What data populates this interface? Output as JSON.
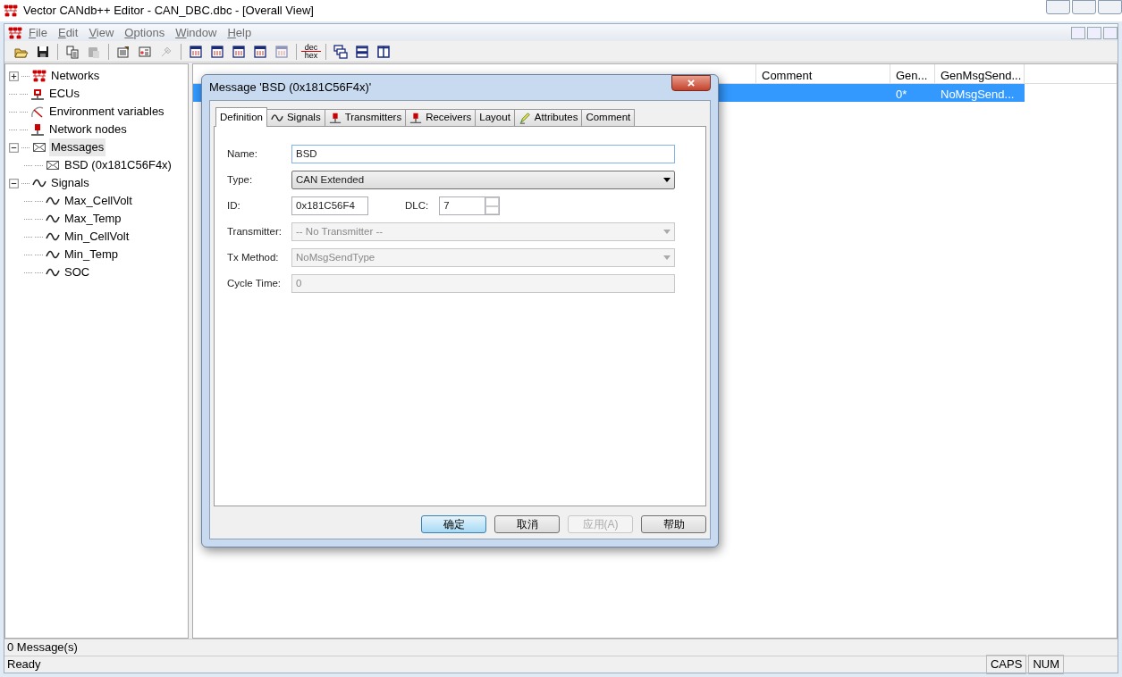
{
  "window": {
    "title": "Vector CANdb++ Editor - CAN_DBC.dbc - [Overall View]"
  },
  "menu": [
    {
      "label": "File"
    },
    {
      "label": "Edit"
    },
    {
      "label": "View"
    },
    {
      "label": "Options"
    },
    {
      "label": "Window"
    },
    {
      "label": "Help"
    }
  ],
  "toolbar": [
    {
      "kind": "open",
      "disabled": false
    },
    {
      "kind": "save",
      "disabled": false
    },
    {
      "kind": "sep"
    },
    {
      "kind": "copy",
      "disabled": false
    },
    {
      "kind": "paste",
      "disabled": true
    },
    {
      "kind": "sep"
    },
    {
      "kind": "props",
      "disabled": false
    },
    {
      "kind": "card",
      "disabled": false
    },
    {
      "kind": "tool",
      "disabled": true
    },
    {
      "kind": "sep"
    },
    {
      "kind": "win",
      "disabled": false
    },
    {
      "kind": "win",
      "disabled": false
    },
    {
      "kind": "win",
      "disabled": false
    },
    {
      "kind": "win",
      "disabled": false
    },
    {
      "kind": "win",
      "disabled": true
    },
    {
      "kind": "sep"
    },
    {
      "kind": "text",
      "lines": [
        "dec",
        "hex"
      ]
    },
    {
      "kind": "sep"
    },
    {
      "kind": "cascade",
      "disabled": false
    },
    {
      "kind": "hsplit",
      "disabled": false
    },
    {
      "kind": "vsplit",
      "disabled": false
    }
  ],
  "tree": [
    {
      "label": "Networks",
      "kind": "network",
      "expanded": false,
      "selected": false
    },
    {
      "label": "ECUs",
      "kind": "ecu",
      "selected": false
    },
    {
      "label": "Environment variables",
      "kind": "gauge",
      "selected": false
    },
    {
      "label": "Network nodes",
      "kind": "node",
      "selected": false
    },
    {
      "label": "Messages",
      "kind": "message",
      "expanded": true,
      "selected": true,
      "children": [
        {
          "label": "BSD (0x181C56F4x)",
          "kind": "message",
          "selected": false
        }
      ]
    },
    {
      "label": "Signals",
      "kind": "signal",
      "expanded": true,
      "selected": false,
      "children": [
        {
          "label": "Max_CellVolt",
          "kind": "signal",
          "selected": false
        },
        {
          "label": "Max_Temp",
          "kind": "signal",
          "selected": false
        },
        {
          "label": "Min_CellVolt",
          "kind": "signal",
          "selected": false
        },
        {
          "label": "Min_Temp",
          "kind": "signal",
          "selected": false
        },
        {
          "label": "SOC",
          "kind": "signal",
          "selected": false
        }
      ]
    }
  ],
  "table": {
    "columns": [
      "Comment",
      "Gen...",
      "GenMsgSend..."
    ],
    "rows": [
      {
        "cells": [
          "",
          "0*",
          "NoMsgSend..."
        ],
        "selected": true
      }
    ]
  },
  "dialog": {
    "title": "Message 'BSD (0x181C56F4x)'",
    "tabs": [
      {
        "label": "Definition",
        "kind": "plain",
        "selected": true
      },
      {
        "label": "Signals",
        "kind": "signal",
        "selected": false
      },
      {
        "label": "Transmitters",
        "kind": "node",
        "selected": false
      },
      {
        "label": "Receivers",
        "kind": "node",
        "selected": false
      },
      {
        "label": "Layout",
        "kind": "plain",
        "selected": false
      },
      {
        "label": "Attributes",
        "kind": "pencil",
        "selected": false
      },
      {
        "label": "Comment",
        "kind": "plain",
        "selected": false
      }
    ],
    "name": {
      "label": "Name:",
      "value": "BSD"
    },
    "type": {
      "label": "Type:",
      "value": "CAN Extended"
    },
    "id": {
      "label": "ID:",
      "value": "0x181C56F4"
    },
    "dlc": {
      "label": "DLC:",
      "value": "7"
    },
    "fields": [
      {
        "label": "Transmitter:",
        "kind": "select",
        "value": "-- No Transmitter --",
        "disabled": true
      },
      {
        "label": "Tx Method:",
        "kind": "select",
        "value": "NoMsgSendType",
        "disabled": true
      },
      {
        "label": "Cycle Time:",
        "kind": "text",
        "value": "0",
        "disabled": true
      }
    ],
    "buttons": [
      {
        "label": "确定",
        "default": true,
        "disabled": false
      },
      {
        "label": "取消",
        "default": false,
        "disabled": false
      },
      {
        "label": "应用(A)",
        "default": false,
        "disabled": true
      },
      {
        "label": "帮助",
        "default": false,
        "disabled": false
      }
    ]
  },
  "status_bar": {
    "count": "0 Message(s)",
    "text": "Ready",
    "indicators": [
      "CAPS",
      "NUM"
    ]
  }
}
